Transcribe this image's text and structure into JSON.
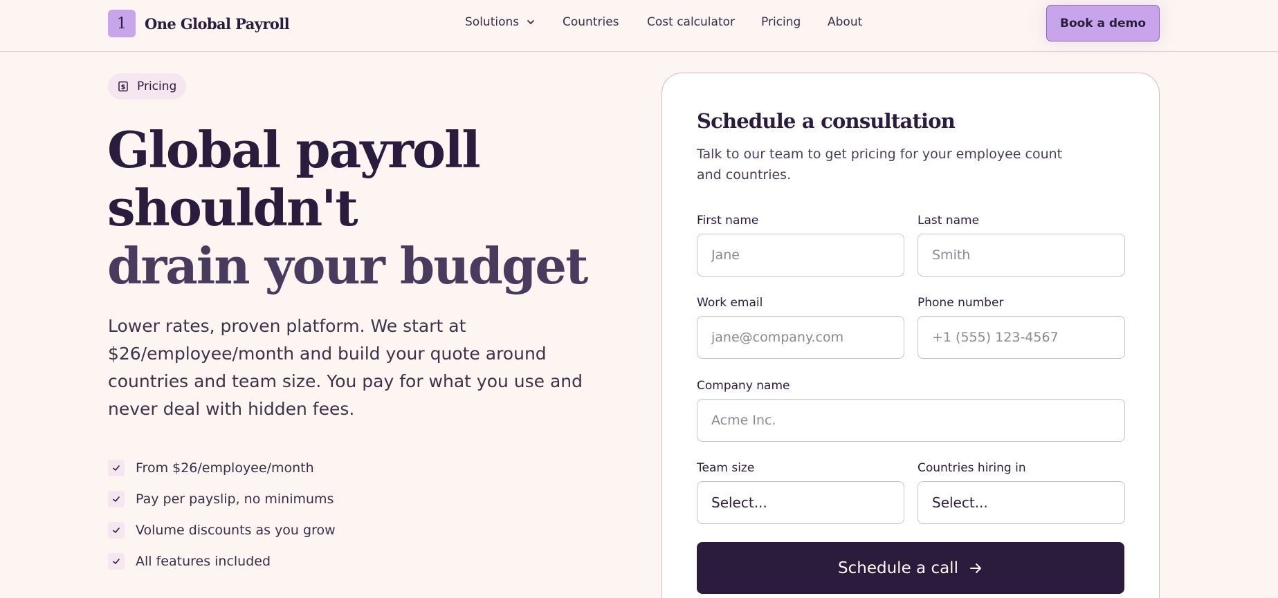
{
  "header": {
    "logo_mark": "1",
    "brand": "One Global Payroll",
    "nav": {
      "solutions": "Solutions",
      "countries": "Countries",
      "cost_calculator": "Cost calculator",
      "pricing": "Pricing",
      "about": "About"
    },
    "cta": "Book a demo"
  },
  "hero": {
    "badge": "Pricing",
    "title_line1": "Global payroll",
    "title_line2": "shouldn't",
    "title_line3": "drain your budget",
    "subtitle": "Lower rates, proven platform. We start at $26/employee/month and build your quote around countries and team size. You pay for what you use and never deal with hidden fees.",
    "features": [
      "From $26/employee/month",
      "Pay per payslip, no minimums",
      "Volume discounts as you grow",
      "All features included"
    ]
  },
  "form": {
    "title": "Schedule a consultation",
    "subtitle": "Talk to our team to get pricing for your employee count and countries.",
    "first_name": {
      "label": "First name",
      "placeholder": "Jane"
    },
    "last_name": {
      "label": "Last name",
      "placeholder": "Smith"
    },
    "work_email": {
      "label": "Work email",
      "placeholder": "jane@company.com"
    },
    "phone": {
      "label": "Phone number",
      "placeholder": "+1 (555) 123-4567"
    },
    "company": {
      "label": "Company name",
      "placeholder": "Acme Inc."
    },
    "team_size": {
      "label": "Team size",
      "value": "Select..."
    },
    "countries": {
      "label": "Countries hiring in",
      "value": "Select..."
    },
    "submit": "Schedule a call"
  },
  "colors": {
    "background": "#fdf5f1",
    "brand": "#c8a5ea",
    "dark": "#2b1b3d"
  },
  "icons": {
    "badge": "dollar-document-icon",
    "nav_chevron": "chevron-down-icon",
    "feature_check": "check-icon",
    "submit_arrow": "arrow-right-icon"
  }
}
